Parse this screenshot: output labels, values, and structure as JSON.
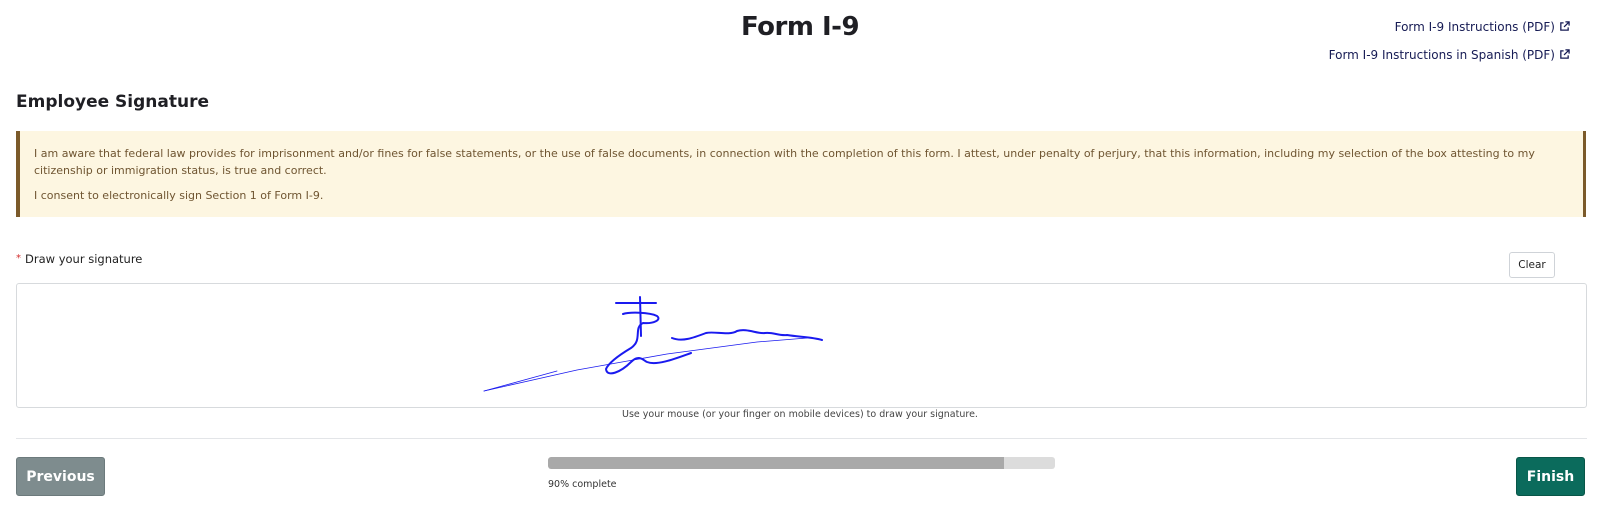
{
  "header": {
    "title": "Form I-9",
    "links": [
      {
        "label": "Form I-9 Instructions (PDF)",
        "icon": "external-link-icon"
      },
      {
        "label": "Form I-9 Instructions in Spanish (PDF)",
        "icon": "external-link-icon"
      }
    ]
  },
  "section": {
    "heading": "Employee Signature"
  },
  "notice": {
    "paragraph1": "I am aware that federal law provides for imprisonment and/or fines for false statements, or the use of false documents, in connection with the completion of this form. I attest, under penalty of perjury, that this information, including my selection of the box attesting to my citizenship or immigration status, is true and correct.",
    "paragraph2": "I consent to electronically sign Section 1 of Form I-9.",
    "background_color": "#fdf6e1",
    "border_color": "#7b5a2a"
  },
  "signature": {
    "required_marker": "*",
    "label": "Draw your signature",
    "clear_label": "Clear",
    "hint": "Use your mouse (or your finger on mobile devices) to draw your signature.",
    "stroke_color": "#1a1aef"
  },
  "footer": {
    "previous_label": "Previous",
    "finish_label": "Finish",
    "progress_fraction": 0.9,
    "progress_text": "90% complete",
    "previous_color": "#7e8c8e",
    "finish_color": "#0b6b5c"
  }
}
